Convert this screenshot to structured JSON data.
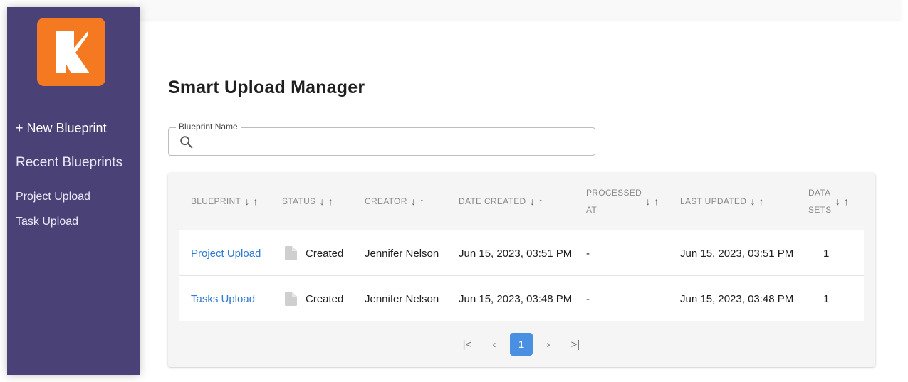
{
  "sidebar": {
    "new_blueprint": "+ New Blueprint",
    "recent_title": "Recent Blueprints",
    "recent_items": [
      "Project Upload",
      "Task Upload"
    ]
  },
  "page_title": "Smart Upload Manager",
  "search": {
    "label": "Blueprint Name",
    "value": ""
  },
  "table": {
    "headers": {
      "blueprint": "BLUEPRINT",
      "status": "STATUS",
      "creator": "CREATOR",
      "date_created": "DATE CREATED",
      "processed_line1": "PROCESSED",
      "processed_line2": "AT",
      "last_updated": "LAST UPDATED",
      "data_sets_line1": "DATA",
      "data_sets_line2": "SETS"
    },
    "rows": [
      {
        "blueprint": "Project Upload",
        "status": "Created",
        "creator": "Jennifer Nelson",
        "date_created": "Jun 15, 2023, 03:51 PM",
        "processed_at": "-",
        "last_updated": "Jun 15, 2023, 03:51 PM",
        "data_sets": "1"
      },
      {
        "blueprint": "Tasks Upload",
        "status": "Created",
        "creator": "Jennifer Nelson",
        "date_created": "Jun 15, 2023, 03:48 PM",
        "processed_at": "-",
        "last_updated": "Jun 15, 2023, 03:48 PM",
        "data_sets": "1"
      }
    ]
  },
  "pagination": {
    "first": "|<",
    "prev": "‹",
    "current": "1",
    "next": "›",
    "last": ">|"
  },
  "icons": {
    "sort_desc": "↓",
    "sort_asc": "↑"
  },
  "colors": {
    "sidebar": "#4a4176",
    "logo": "#f47920",
    "link": "#2f7bd2",
    "active_page": "#4a90e2"
  }
}
